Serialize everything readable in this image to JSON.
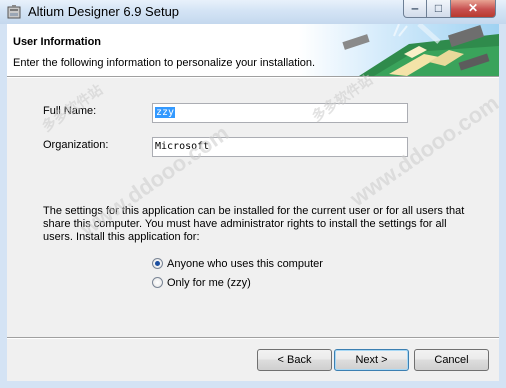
{
  "window": {
    "title": "Altium Designer 6.9 Setup",
    "minimize": "‒",
    "maximize": "□",
    "close": "✕"
  },
  "header": {
    "title": "User Information",
    "subtitle": "Enter the following information to personalize your installation."
  },
  "form": {
    "full_name_label": "Full Name:",
    "full_name_value": "zzy",
    "organization_label": "Organization:",
    "organization_value": "Microsoft"
  },
  "info_text": "The settings for this application can be installed for the current user or for all users that share this computer. You must have administrator rights to install the settings for all users. Install this application for:",
  "install_for": {
    "options": [
      {
        "label": "Anyone who uses this computer",
        "selected": true
      },
      {
        "label": "Only for me (zzy)",
        "selected": false
      }
    ]
  },
  "buttons": {
    "back": "< Back",
    "next": "Next >",
    "cancel": "Cancel"
  },
  "watermark": {
    "text": "www.ddooo.com",
    "cn": "多多软件站"
  }
}
